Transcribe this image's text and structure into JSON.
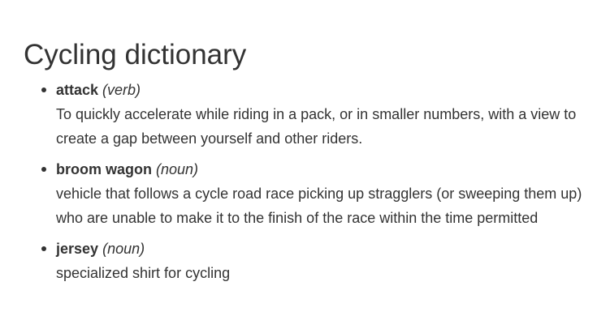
{
  "title": "Cycling dictionary",
  "entries": [
    {
      "term": "attack",
      "pos": "(verb)",
      "definition": "To quickly accelerate while riding in a pack, or in smaller numbers, with a view to create a gap between yourself and other riders."
    },
    {
      "term": "broom wagon",
      "pos": "(noun)",
      "definition": "vehicle that follows a cycle road race picking up stragglers (or sweeping them up) who are unable to make it to the finish of the race within the time permitted"
    },
    {
      "term": "jersey",
      "pos": "(noun)",
      "definition": "specialized shirt for cycling"
    }
  ],
  "colors": {
    "text": "#333333",
    "background": "#ffffff"
  }
}
